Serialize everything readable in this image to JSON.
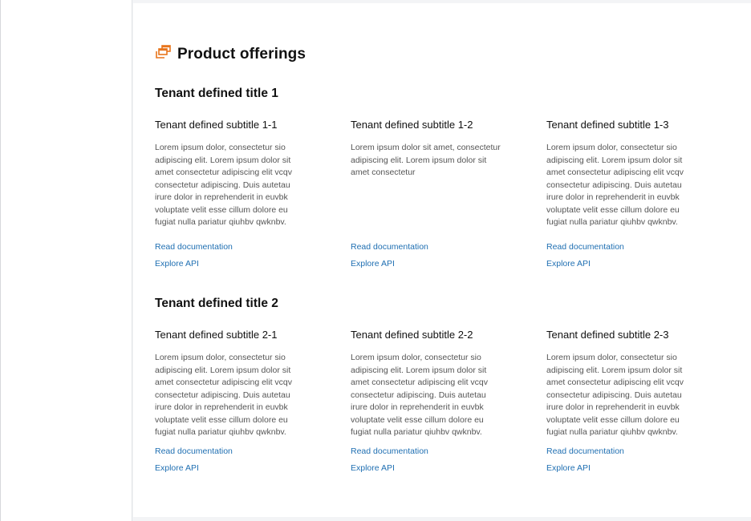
{
  "page": {
    "title": "Product offerings",
    "icon": "stacked-windows-icon",
    "accent_color": "#e8741c",
    "link_color": "#1f6fb2"
  },
  "sections": [
    {
      "title": "Tenant defined title 1",
      "cards": [
        {
          "subtitle": "Tenant defined subtitle 1-1",
          "description": "Lorem ipsum dolor, consectetur sio adipiscing elit. Lorem ipsum dolor sit amet consectetur adipiscing elit vcqv consectetur adipiscing. Duis autetau irure dolor in reprehenderit in euvbk voluptate velit esse cillum dolore eu fugiat nulla pariatur qiuhbv qwknbv.",
          "link1": "Read documentation",
          "link2": "Explore API"
        },
        {
          "subtitle": "Tenant defined subtitle 1-2",
          "description": "Lorem ipsum dolor sit amet, consectetur adipiscing elit. Lorem ipsum dolor sit amet consectetur",
          "link1": "Read documentation",
          "link2": "Explore API"
        },
        {
          "subtitle": "Tenant defined subtitle 1-3",
          "description": "Lorem ipsum dolor, consectetur sio adipiscing elit. Lorem ipsum dolor sit amet consectetur adipiscing elit vcqv consectetur adipiscing. Duis autetau irure dolor in reprehenderit in euvbk voluptate velit esse cillum dolore eu fugiat nulla pariatur qiuhbv qwknbv.",
          "link1": "Read documentation",
          "link2": "Explore API"
        }
      ]
    },
    {
      "title": "Tenant defined title 2",
      "cards": [
        {
          "subtitle": "Tenant defined subtitle 2-1",
          "description": "Lorem ipsum dolor, consectetur sio adipiscing elit. Lorem ipsum dolor sit amet consectetur adipiscing elit vcqv consectetur adipiscing. Duis autetau irure dolor in reprehenderit in euvbk voluptate velit esse cillum dolore eu fugiat nulla pariatur qiuhbv qwknbv.",
          "link1": "Read documentation",
          "link2": "Explore API"
        },
        {
          "subtitle": "Tenant defined subtitle 2-2",
          "description": "Lorem ipsum dolor, consectetur sio adipiscing elit. Lorem ipsum dolor sit amet consectetur adipiscing elit vcqv consectetur adipiscing. Duis autetau irure dolor in reprehenderit in euvbk voluptate velit esse cillum dolore eu fugiat nulla pariatur qiuhbv qwknbv.",
          "link1": "Read documentation",
          "link2": "Explore API"
        },
        {
          "subtitle": "Tenant defined subtitle 2-3",
          "description": "Lorem ipsum dolor, consectetur sio adipiscing elit. Lorem ipsum dolor sit amet consectetur adipiscing elit vcqv consectetur adipiscing. Duis autetau irure dolor in reprehenderit in euvbk voluptate velit esse cillum dolore eu fugiat nulla pariatur qiuhbv qwknbv.",
          "link1": "Read documentation",
          "link2": "Explore API"
        }
      ]
    }
  ]
}
